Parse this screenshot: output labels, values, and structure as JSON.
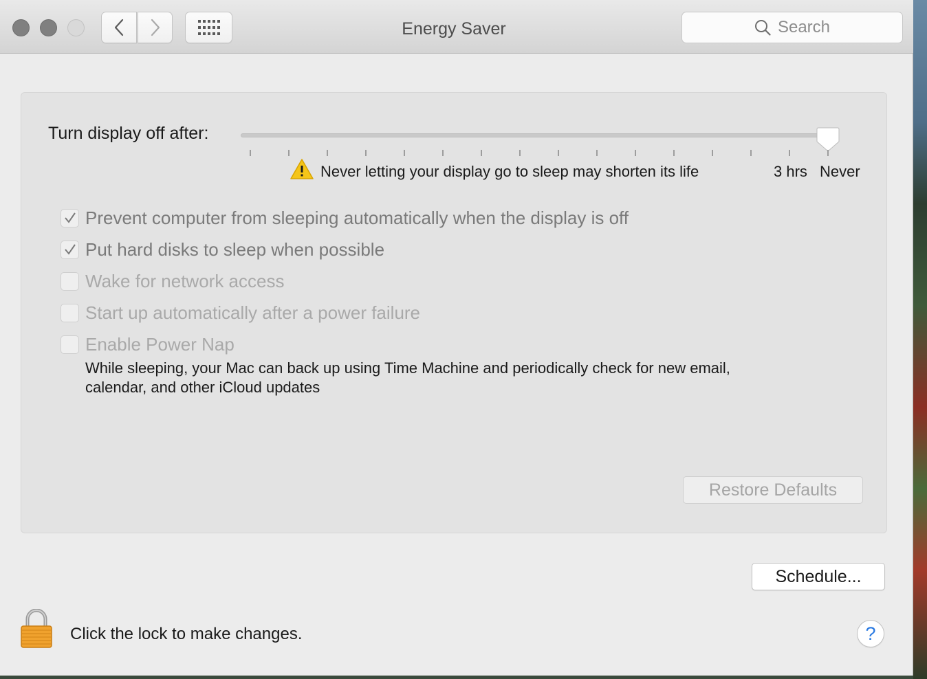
{
  "window": {
    "title": "Energy Saver",
    "search_placeholder": "Search"
  },
  "slider": {
    "label": "Turn display off after:",
    "warning": "Never letting your display go to sleep may shorten its life",
    "tick_labels": [
      "3 hrs",
      "Never"
    ],
    "selected": "Never",
    "value_fraction": 1.0
  },
  "options": [
    {
      "label": "Prevent computer from sleeping automatically when the display is off",
      "checked": true,
      "enabled": true
    },
    {
      "label": "Put hard disks to sleep when possible",
      "checked": true,
      "enabled": true
    },
    {
      "label": "Wake for network access",
      "checked": false,
      "enabled": false
    },
    {
      "label": "Start up automatically after a power failure",
      "checked": false,
      "enabled": false
    },
    {
      "label": "Enable Power Nap",
      "checked": false,
      "enabled": false
    }
  ],
  "power_nap_description": "While sleeping, your Mac can back up using Time Machine and periodically check for new email, calendar, and other iCloud updates",
  "buttons": {
    "restore_defaults": "Restore Defaults",
    "schedule": "Schedule...",
    "help": "?"
  },
  "lock": {
    "text": "Click the lock to make changes.",
    "locked": true
  },
  "colors": {
    "window_bg": "#ececec",
    "panel_bg": "#e3e3e3",
    "warning_yellow": "#f5c518",
    "help_blue": "#2a7ae2",
    "lock_orange": "#f0a22e"
  }
}
